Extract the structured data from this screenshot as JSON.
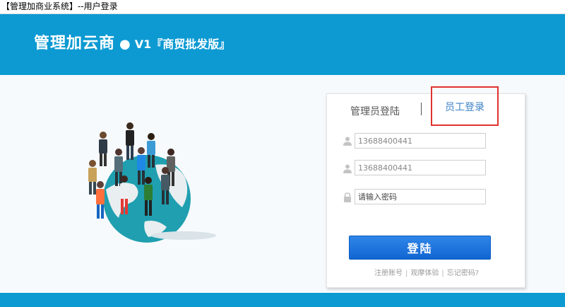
{
  "window": {
    "title": "【管理加商业系统】--用户登录"
  },
  "banner": {
    "brand": "管理加云商",
    "dot": "●",
    "version": "V1『商贸批发版』"
  },
  "login": {
    "tabs": {
      "admin": "管理员登陆",
      "staff": "员工登录",
      "active": "staff"
    },
    "fields": {
      "company": {
        "value": "13688400441",
        "icon": "user-icon"
      },
      "account": {
        "value": "13688400441",
        "icon": "user-icon"
      },
      "password": {
        "value": "",
        "placeholder": "请输入密码",
        "icon": "lock-icon"
      }
    },
    "submit_label": "登陆",
    "links": {
      "register": "注册账号",
      "demo": "观摩体验",
      "forgot": "忘记密码?"
    }
  },
  "colors": {
    "banner": "#0d9ad2",
    "button": "#1a6fd9",
    "highlight_box": "#e0322f",
    "active_tab": "#3b82c4"
  }
}
